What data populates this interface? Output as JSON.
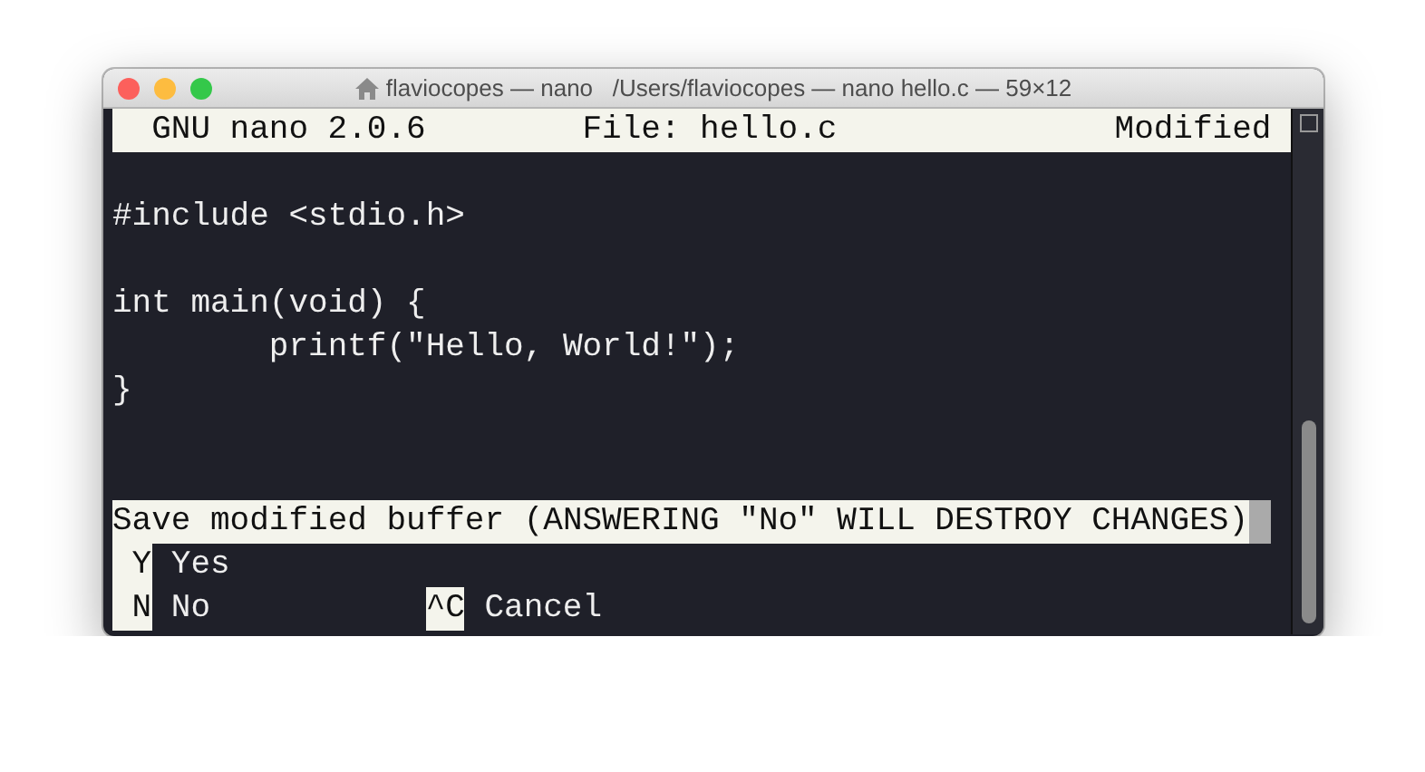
{
  "window": {
    "title": "flaviocopes — nano   /Users/flaviocopes — nano hello.c — 59×12"
  },
  "header": {
    "app": "GNU nano 2.0.6",
    "file": "File: hello.c",
    "status": "Modified"
  },
  "buffer": "\n#include <stdio.h>\n\nint main(void) {\n\tprintf(\"Hello, World!\");\n}\n\n",
  "prompt": "Save modified buffer (ANSWERING \"No\" WILL DESTROY CHANGES)",
  "shortcut_rows": [
    [
      {
        "key": "Y",
        "label": "Yes"
      }
    ],
    [
      {
        "key": "N",
        "label": "No"
      },
      {
        "key": "^C",
        "label": "Cancel"
      }
    ]
  ]
}
